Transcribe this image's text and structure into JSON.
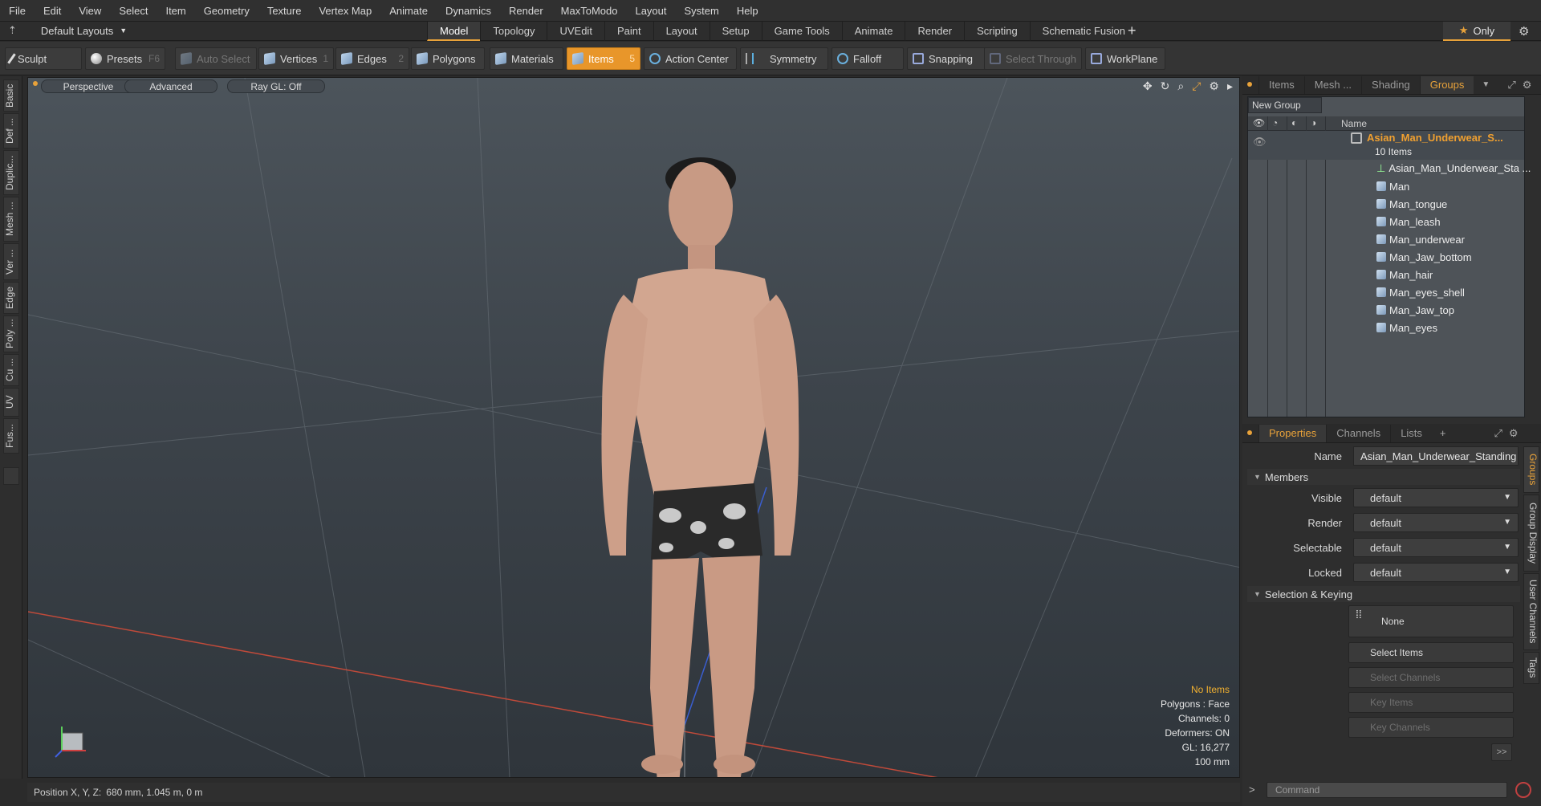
{
  "menubar": {
    "items": [
      "File",
      "Edit",
      "View",
      "Select",
      "Item",
      "Geometry",
      "Texture",
      "Vertex Map",
      "Animate",
      "Dynamics",
      "Render",
      "MaxToModo",
      "Layout",
      "System",
      "Help"
    ]
  },
  "layoutbar": {
    "layouts_label": "Default Layouts",
    "tabs": [
      "Model",
      "Topology",
      "UVEdit",
      "Paint",
      "Layout",
      "Setup",
      "Game Tools",
      "Animate",
      "Render",
      "Scripting",
      "Schematic Fusion"
    ],
    "active_tab": "Model",
    "only_label": "Only"
  },
  "toolbar": {
    "sculpt": "Sculpt",
    "presets": "Presets",
    "presets_hotkey": "F6",
    "auto_select": "Auto Select",
    "vertices": "Vertices",
    "vertices_hotkey": "1",
    "edges": "Edges",
    "edges_hotkey": "2",
    "polygons": "Polygons",
    "materials": "Materials",
    "items": "Items",
    "items_hotkey": "5",
    "action_center": "Action Center",
    "symmetry": "Symmetry",
    "falloff": "Falloff",
    "snapping": "Snapping",
    "select_through": "Select Through",
    "workplane": "WorkPlane"
  },
  "left_tabs": [
    "Basic",
    "Def ...",
    "Duplic...",
    "Mesh ...",
    "Ver ...",
    "Edge",
    "Poly ...",
    "Cu ...",
    "UV",
    "Fus..."
  ],
  "viewport": {
    "view_mode": "Perspective",
    "shading": "Advanced",
    "raygl": "Ray GL: Off",
    "hud": {
      "warning": "No Items",
      "lines": [
        "Polygons : Face",
        "Channels: 0",
        "Deformers: ON",
        "GL: 16,277",
        "100 mm"
      ]
    }
  },
  "statusbar": {
    "label": "Position X, Y, Z:",
    "value": "680 mm, 1.045 m, 0 m"
  },
  "groups_panel": {
    "tabs": [
      "Items",
      "Mesh ...",
      "Shading",
      "Groups"
    ],
    "active_tab": "Groups",
    "new_group": "New Group",
    "column_name": "Name",
    "group_name": "Asian_Man_Underwear_S...",
    "group_count": "10 Items",
    "children": [
      "Asian_Man_Underwear_Sta ...",
      "Man",
      "Man_tongue",
      "Man_leash",
      "Man_underwear",
      "Man_Jaw_bottom",
      "Man_hair",
      "Man_eyes_shell",
      "Man_Jaw_top",
      "Man_eyes"
    ]
  },
  "properties_panel": {
    "tabs": [
      "Properties",
      "Channels",
      "Lists"
    ],
    "active_tab": "Properties",
    "name_label": "Name",
    "name_value": "Asian_Man_Underwear_Standing",
    "members_label": "Members",
    "fields": [
      {
        "label": "Visible",
        "value": "default"
      },
      {
        "label": "Render",
        "value": "default"
      },
      {
        "label": "Selectable",
        "value": "default"
      },
      {
        "label": "Locked",
        "value": "default"
      }
    ],
    "selection_label": "Selection & Keying",
    "none_label": "None",
    "select_items": "Select Items",
    "select_channels": "Select Channels",
    "key_items": "Key Items",
    "key_channels": "Key Channels",
    "more": ">>",
    "side_tabs": [
      "Groups",
      "Group Display",
      "User Channels",
      "Tags"
    ],
    "command_placeholder": "Command"
  },
  "colors": {
    "accent": "#e8962a",
    "group_name": "#f0a030"
  }
}
